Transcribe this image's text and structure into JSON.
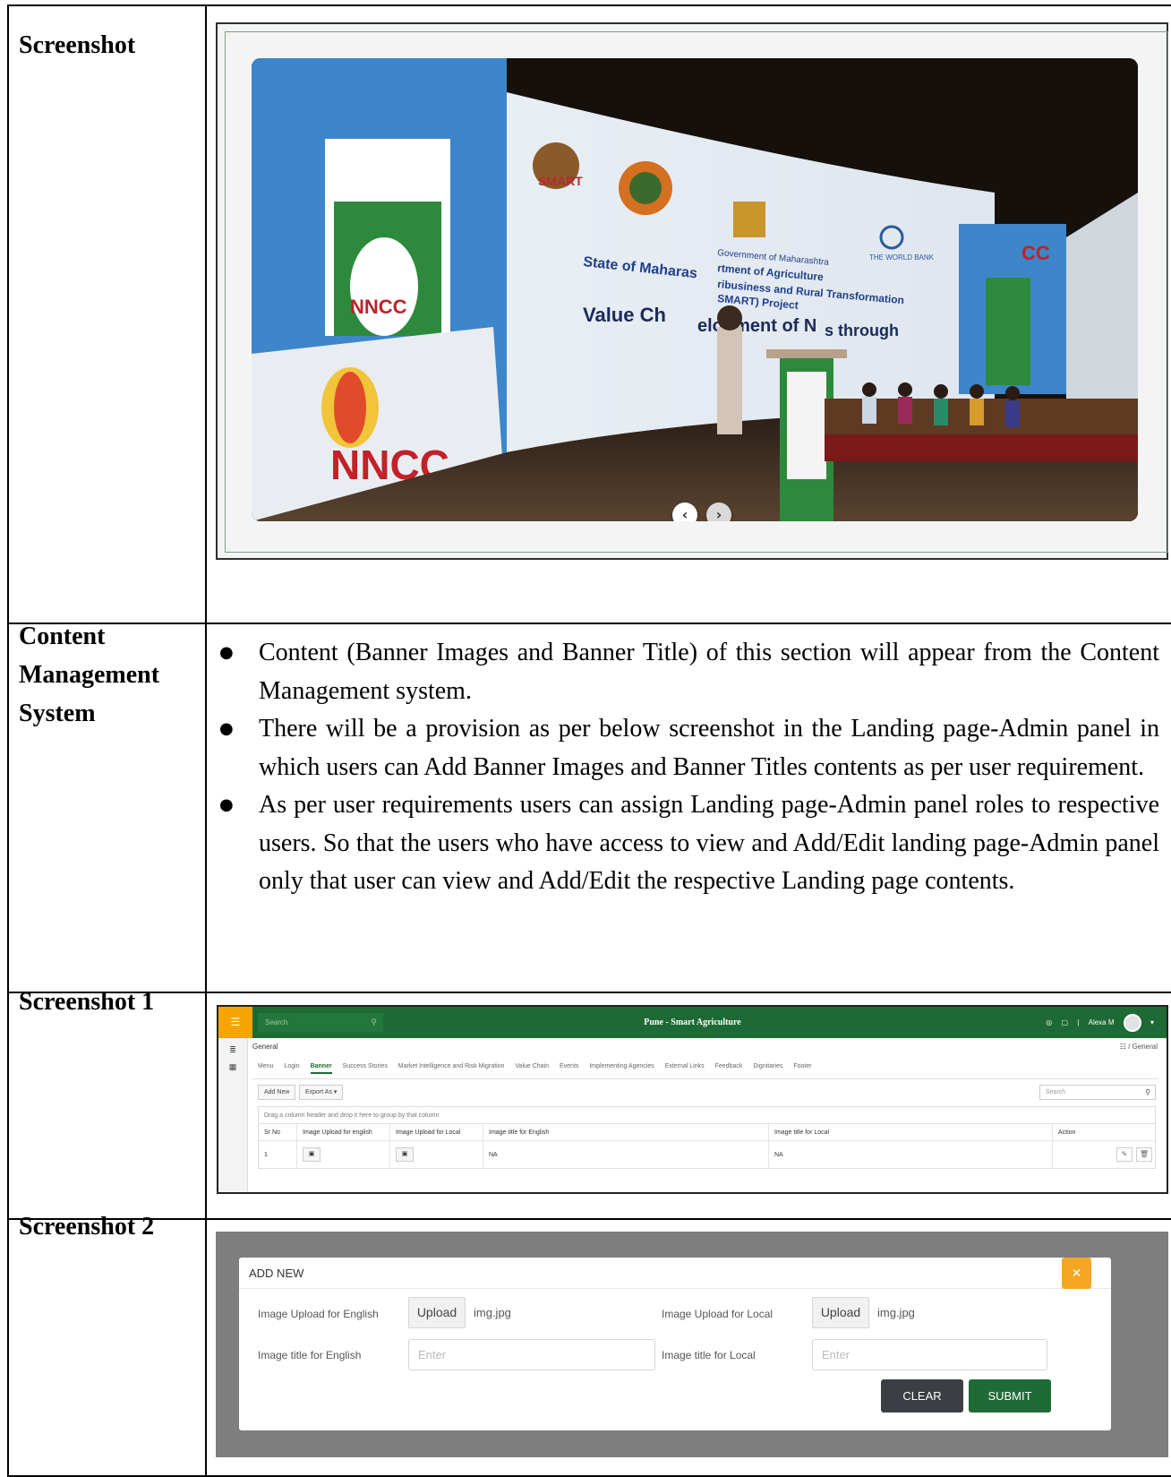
{
  "rows": [
    {
      "label": "Screenshot"
    },
    {
      "label": "Content Management System"
    },
    {
      "label": "Screenshot 1"
    },
    {
      "label": "Screenshot 2"
    }
  ],
  "cms_bullets": [
    "Content (Banner Images and Banner Title) of this section will appear from the Content Management system.",
    "There will be a provision as per below screenshot in the Landing page-Admin panel in which users can Add Banner Images and Banner Titles contents as per user requirement.",
    "As per user requirements users can assign Landing page-Admin panel roles to respective users. So that the users who have access to view and Add/Edit landing page-Admin panel only that user can view and Add/Edit the respective Landing page contents."
  ],
  "banner": {
    "prev_icon": "chevron-left-icon",
    "next_icon": "chevron-right-icon",
    "photo_text": {
      "left_screen_1": "NNCC",
      "left_screen_2": "NNCC",
      "stage_line_1": "State of Maharas",
      "stage_line_2": "Value Ch",
      "stage_line_3": "elopment of N",
      "stage_line_4": "s through",
      "gov_1": "Government of Maharashtra",
      "gov_2": "rtment of Agriculture",
      "gov_3": "ribusiness and Rural Transformation",
      "gov_4": "SMART) Project",
      "world_bank": "THE WORLD BANK",
      "smart_logo": "SMART",
      "right_screen": "CC"
    }
  },
  "admin_grid": {
    "search_placeholder": "Search",
    "app_title": "Pune - Smart Agriculture",
    "user_name": "Alexa M",
    "section_title": "General",
    "breadcrumb": "/ General",
    "tabs": [
      "Menu",
      "Login",
      "Banner",
      "Success Stories",
      "Market Intelligence and Risk Migration",
      "Value Chain",
      "Events",
      "Implementing Agencies",
      "External Links",
      "Feedback",
      "Dignitaries",
      "Footer"
    ],
    "active_tab": "Banner",
    "add_new_label": "Add New",
    "export_label": "Export As",
    "grid_search_placeholder": "Search",
    "group_hint": "Drag a column header and drop it here to group by that column",
    "columns": [
      "Sr No",
      "Image Upload for english",
      "Image Upload for Local",
      "Image title for English",
      "Image title for Local",
      "Action"
    ],
    "rows": [
      {
        "sr_no": "1",
        "title_en": "NA",
        "title_local": "NA"
      }
    ]
  },
  "add_new_dialog": {
    "title": "ADD NEW",
    "label_img_en": "Image Upload for English",
    "label_img_local": "Image Upload for Local",
    "label_title_en": "Image title for English",
    "label_title_local": "Image title for Local",
    "upload_label": "Upload",
    "file_en": "img.jpg",
    "file_local": "img.jpg",
    "input_placeholder": "Enter",
    "clear_label": "CLEAR",
    "submit_label": "SUBMIT",
    "close_icon": "close-icon"
  }
}
